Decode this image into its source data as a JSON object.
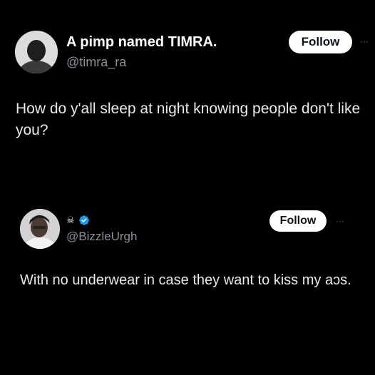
{
  "posts": [
    {
      "display_name": "A pimp named TIMRA.",
      "handle": "@timra_ra",
      "follow_label": "Follow",
      "more_label": "···",
      "text": "How do y'all sleep at night knowing people don't like you?"
    },
    {
      "display_name_emoji": "☠",
      "verified": true,
      "handle": "@BizzleUrgh",
      "follow_label": "Follow",
      "more_label": "···",
      "text": "With no underwear in case they want to kiss my aɔs."
    }
  ],
  "colors": {
    "background": "#000000",
    "primary_text": "#e7e9ea",
    "secondary_text": "#8b9096",
    "follow_bg": "#ffffff",
    "follow_text": "#0f1419",
    "verified_badge": "#1d9bf0"
  },
  "icons": {
    "verified": "verified-badge-icon",
    "more": "more-options-icon"
  }
}
